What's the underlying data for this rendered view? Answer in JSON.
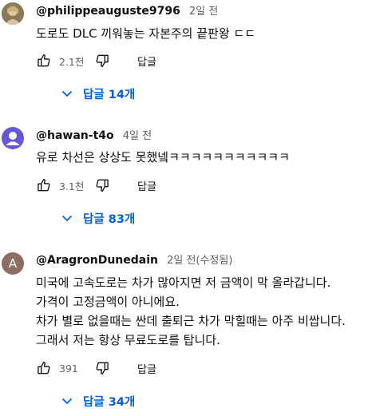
{
  "comments": [
    {
      "author": "@philippeauguste9796",
      "time": "2일 전",
      "body": [
        "도로도 DLC 끼워놓는 자본주의 끝판왕 ㄷㄷ"
      ],
      "likes": "2.1천",
      "reply_label": "답글",
      "replies_label": "답글 14개",
      "avatar_color": "#8a7a5a"
    },
    {
      "author": "@hawan-t4o",
      "time": "4일 전",
      "body": [
        "유로 차선은 상상도 못했넼ㅋㅋㅋㅋㅋㅋㅋㅋㅋㅋㅋ"
      ],
      "likes": "3.1천",
      "reply_label": "답글",
      "replies_label": "답글 83개",
      "avatar_color": "#6757d6"
    },
    {
      "author": "@AragronDunedain",
      "time": "2일 전(수정됨)",
      "avatar_letter": "A",
      "body": [
        "미국에 고속도로는 차가 많아지면 저 금액이 막 올라갑니다.",
        "가격이 고정금액이 아니에요.",
        "차가 별로 없을때는 싼데 출퇴근 차가 막힐때는 아주 비쌉니다.",
        "그래서 저는 항상 무료도로를 탑니다."
      ],
      "likes": "391",
      "reply_label": "답글",
      "replies_label": "답글 34개",
      "avatar_color": "#8d6e63"
    }
  ],
  "colors": {
    "link": "#065fd4",
    "secondary_text": "#606060",
    "primary_text": "#0f0f0f"
  }
}
